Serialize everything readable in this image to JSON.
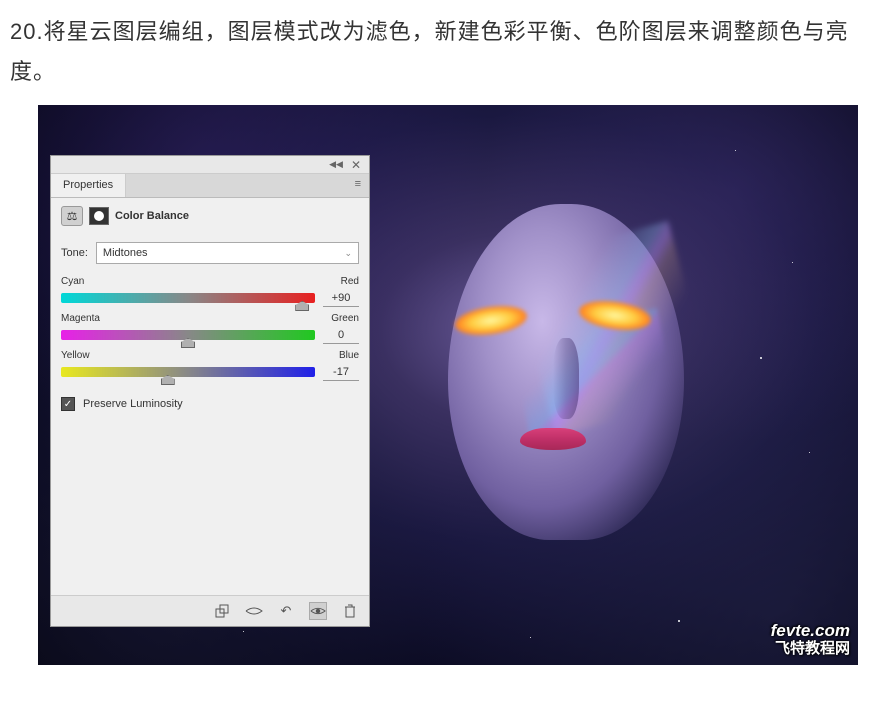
{
  "instruction": "20.将星云图层编组，图层模式改为滤色，新建色彩平衡、色阶图层来调整颜色与亮度。",
  "panel": {
    "tab": "Properties",
    "adjustment_title": "Color Balance",
    "tone_label": "Tone:",
    "tone_value": "Midtones",
    "sliders": [
      {
        "left": "Cyan",
        "right": "Red",
        "value": "+90",
        "pos": 95
      },
      {
        "left": "Magenta",
        "right": "Green",
        "value": "0",
        "pos": 50
      },
      {
        "left": "Yellow",
        "right": "Blue",
        "value": "-17",
        "pos": 42
      }
    ],
    "preserve_label": "Preserve Luminosity",
    "preserve_checked": true
  },
  "watermark": {
    "main": "fevte.com",
    "sub": "飞特教程网"
  }
}
